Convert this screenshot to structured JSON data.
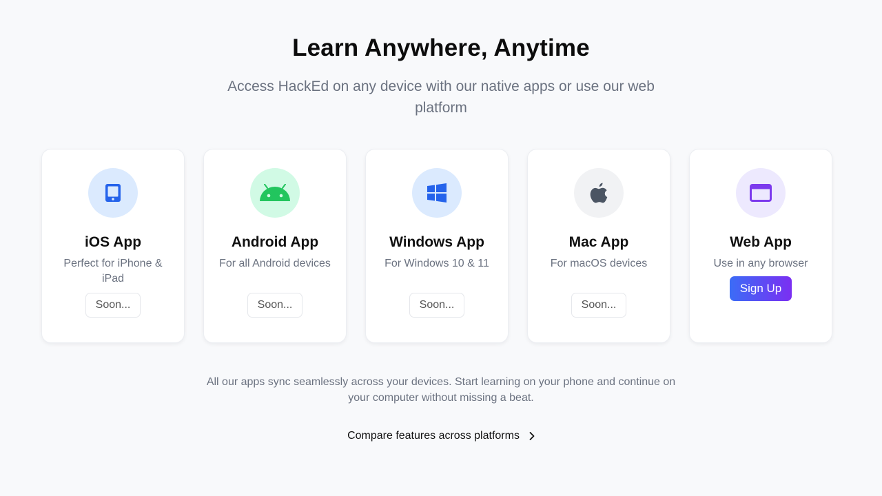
{
  "header": {
    "title": "Learn Anywhere, Anytime",
    "subtitle": "Access HackEd on any device with our native apps or use our web platform"
  },
  "apps": [
    {
      "title": "iOS App",
      "description": "Perfect for iPhone & iPad",
      "button": "Soon...",
      "icon": "tablet-icon",
      "icon_color": "#2563eb",
      "icon_bg": "#dbeafe"
    },
    {
      "title": "Android App",
      "description": "For all Android devices",
      "button": "Soon...",
      "icon": "android-icon",
      "icon_color": "#22c55e",
      "icon_bg": "#d1fae5"
    },
    {
      "title": "Windows App",
      "description": "For Windows 10 & 11",
      "button": "Soon...",
      "icon": "windows-icon",
      "icon_color": "#2563eb",
      "icon_bg": "#dbeafe"
    },
    {
      "title": "Mac App",
      "description": "For macOS devices",
      "button": "Soon...",
      "icon": "apple-icon",
      "icon_color": "#4b5563",
      "icon_bg": "#f1f2f4"
    },
    {
      "title": "Web App",
      "description": "Use in any browser",
      "button": "Sign Up",
      "icon": "browser-window-icon",
      "icon_color": "#7c3aed",
      "icon_bg": "#ede9fe"
    }
  ],
  "footer": {
    "sync_text": "All our apps sync seamlessly across your devices. Start learning on your phone and continue on your computer without missing a beat.",
    "compare_link": "Compare features across platforms"
  },
  "colors": {
    "background": "#f8f9fb",
    "signup_gradient_start": "#3b6cf6",
    "signup_gradient_end": "#7b2ff2"
  }
}
